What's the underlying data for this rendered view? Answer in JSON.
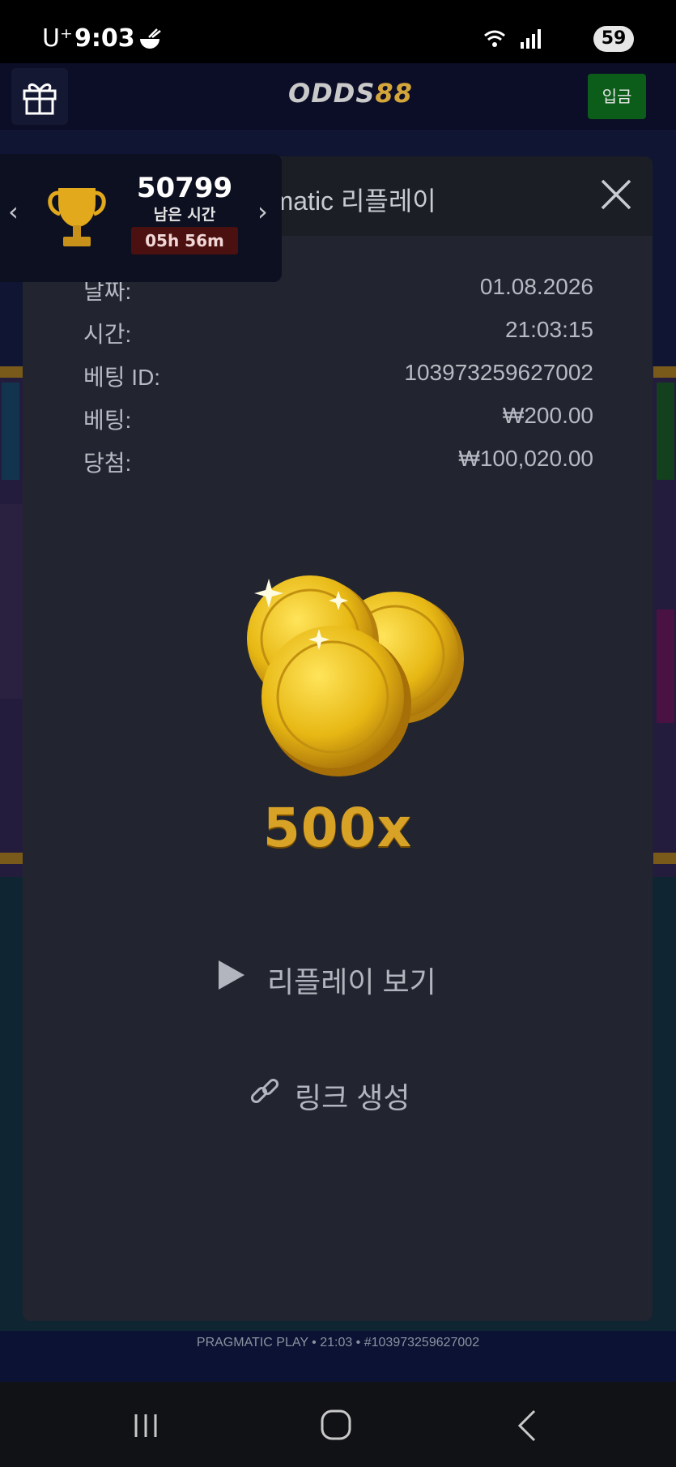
{
  "status_bar": {
    "carrier": "U⁺",
    "time": "9:03",
    "battery": "59"
  },
  "header": {
    "logo_part1": "ODDS",
    "logo_part2": "88",
    "deposit_label": "입금"
  },
  "tournament": {
    "score": "50799",
    "remaining_label": "남은 시간",
    "timer": "05h 56m",
    "prev": "‹",
    "next": "›"
  },
  "modal": {
    "title": "Pragmatic 리플레이",
    "rows": [
      {
        "label": "날짜:",
        "value": "01.08.2026"
      },
      {
        "label": "시간:",
        "value": "21:03:15"
      },
      {
        "label": "베팅 ID:",
        "value": "103973259627002"
      },
      {
        "label": "베팅:",
        "value": "₩200.00"
      },
      {
        "label": "당첨:",
        "value": "₩100,020.00"
      }
    ],
    "multiplier": "500x",
    "replay_label": "리플레이 보기",
    "link_label": "링크 생성"
  },
  "game_footer": {
    "line": "PRAGMATIC PLAY • 21:03 • #103973259627002"
  },
  "colors": {
    "modal_bg": "#22252f",
    "deposit_green": "#0c5c1a",
    "gold": "#d8a226"
  }
}
